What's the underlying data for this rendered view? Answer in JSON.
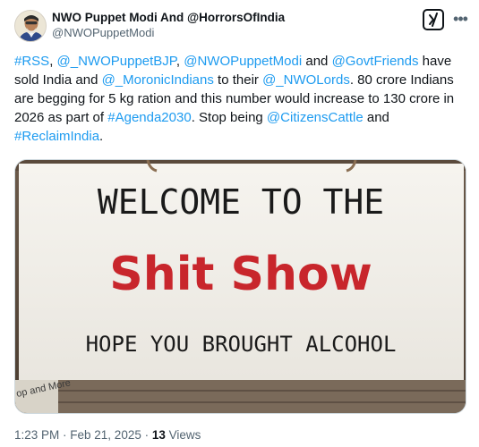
{
  "author": {
    "name": "NWO Puppet Modi And @HorrorsOfIndia",
    "handle": "@NWOPuppetModi"
  },
  "tweet": {
    "segments": [
      {
        "text": "#RSS",
        "type": "link"
      },
      {
        "text": ", ",
        "type": "text"
      },
      {
        "text": "@_NWOPuppetBJP",
        "type": "link"
      },
      {
        "text": ", ",
        "type": "text"
      },
      {
        "text": "@NWOPuppetModi",
        "type": "link"
      },
      {
        "text": " and ",
        "type": "text"
      },
      {
        "text": "@GovtFriends",
        "type": "link"
      },
      {
        "text": " have sold India and ",
        "type": "text"
      },
      {
        "text": "@_MoronicIndians",
        "type": "link"
      },
      {
        "text": " to their ",
        "type": "text"
      },
      {
        "text": "@_NWOLords",
        "type": "link"
      },
      {
        "text": ". 80 crore Indians are begging for 5 kg ration and this number would increase to 130 crore in 2026 as part of ",
        "type": "text"
      },
      {
        "text": "#Agenda2030",
        "type": "link"
      },
      {
        "text": ". Stop being ",
        "type": "text"
      },
      {
        "text": "@CitizensCattle",
        "type": "link"
      },
      {
        "text": " and ",
        "type": "text"
      },
      {
        "text": "#ReclaimIndia",
        "type": "link"
      },
      {
        "text": ".",
        "type": "text"
      }
    ]
  },
  "media": {
    "sign_line1": "WELCOME TO THE",
    "sign_line2": "Shit Show",
    "sign_line3": "HOPE YOU BROUGHT ALCOHOL",
    "corner_text": "op and More"
  },
  "meta": {
    "time": "1:23 PM",
    "sep1": " · ",
    "date": "Feb 21, 2025",
    "sep2": " · ",
    "views_count": "13",
    "views_label": " Views"
  },
  "colors": {
    "link": "#1d9bf0",
    "sign_red": "#c8262c",
    "sign_black": "#1a1a1a",
    "secondary_text": "#536471"
  },
  "icons": {
    "grok": "grok-icon",
    "more": "more-icon"
  }
}
